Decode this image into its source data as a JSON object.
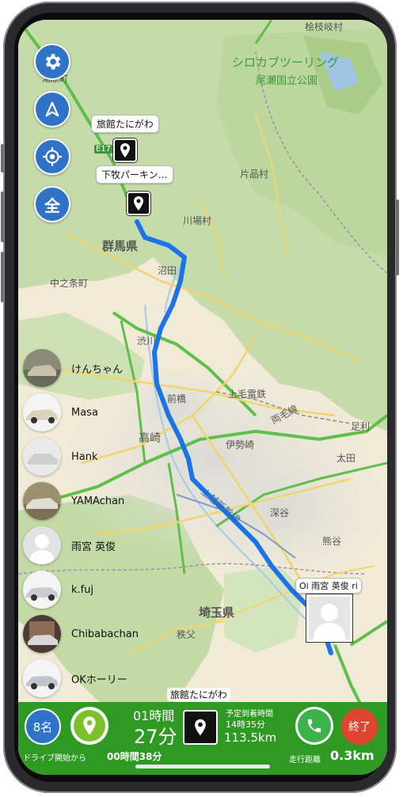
{
  "map": {
    "labels": {
      "place_top_right": "桧枝岐村",
      "place_top_left": "湯原町",
      "park_name_1": "シロカブツーリング",
      "park_name_2": "尾瀬国立公園",
      "highway": "E17",
      "katashina": "片品村",
      "kawaba": "川場村",
      "gunma": "群馬県",
      "numata": "沼田",
      "nakanojo": "中之条町",
      "shibukawa": "渋川",
      "maebashi": "前橋",
      "kamimo_dentetsu": "上毛電鉄",
      "ryomo_line": "両毛線",
      "takasaki": "高崎",
      "isesaki": "伊勢崎",
      "ashikaga": "足利",
      "ota": "太田",
      "joetsu_shinkansen": "上越新幹線",
      "fukaya": "深谷",
      "kumagaya": "熊谷",
      "saitama": "埼玉県",
      "chichibu": "秩父"
    }
  },
  "controls": {
    "settings_icon": "gear-icon",
    "navigate_icon": "navigation-arrow-icon",
    "locate_icon": "crosshair-icon",
    "all_label": "全"
  },
  "pins": [
    {
      "label": "旅館たにがわ"
    },
    {
      "label": "下牧パーキン…"
    }
  ],
  "me_marker": {
    "label": "Oi 雨宮 英俊 ri"
  },
  "members": [
    {
      "name": "けんちゃん"
    },
    {
      "name": "Masa"
    },
    {
      "name": "Hank"
    },
    {
      "name": "YAMAchan"
    },
    {
      "name": "雨宮 英俊"
    },
    {
      "name": "k.fuj"
    },
    {
      "name": "Chibabachan"
    },
    {
      "name": "OKホーリー"
    }
  ],
  "bottom": {
    "member_count": "8名",
    "since_start_label": "ドライブ開始から",
    "elapsed": "00時間38分",
    "remaining_hours": "01時間",
    "remaining_minutes": "27分",
    "destination": "旅館たにがわ",
    "eta_label": "予定到着時間",
    "eta_time": "14時35分",
    "distance_remaining": "113.5km",
    "end_label": "終了",
    "driven_label": "走行距離",
    "driven_distance": "0.3km",
    "colors": {
      "bar": "#2e9a24",
      "end_button": "#e0452f",
      "count_button": "#2f73c9",
      "route": "#1a73e8"
    }
  }
}
